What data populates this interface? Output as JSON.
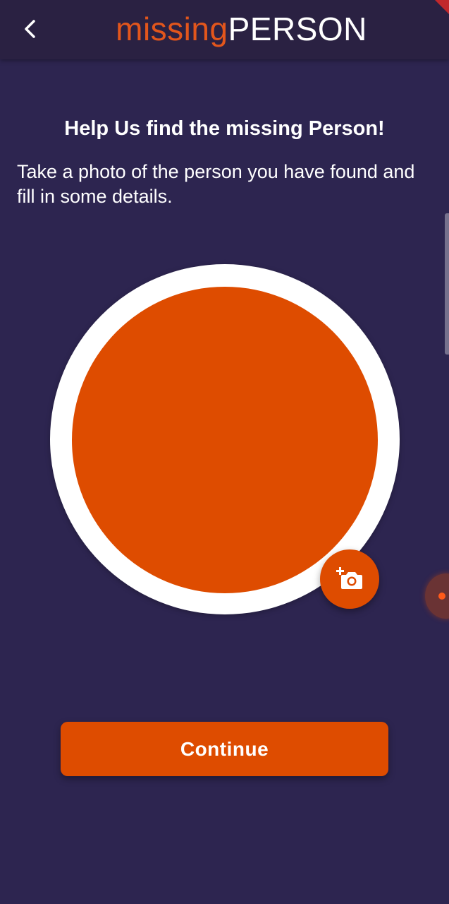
{
  "appbar": {
    "logo_part1": "missing",
    "logo_part2": "PERSON",
    "back_icon": "chevron-left-icon"
  },
  "main": {
    "heading": "Help Us find the missing Person!",
    "instructions": "Take a photo of the person you have found and fill in some details.",
    "add_photo_icon": "add-camera-icon"
  },
  "actions": {
    "continue_label": "Continue"
  },
  "colors": {
    "background": "#2d2550",
    "appbar": "#2a2142",
    "accent": "#de4c00",
    "text": "#ffffff"
  }
}
